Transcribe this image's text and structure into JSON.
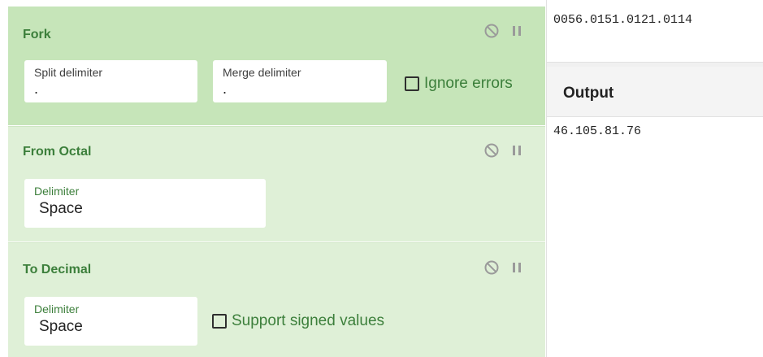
{
  "recipe": {
    "fork": {
      "title": "Fork",
      "split_label": "Split delimiter",
      "split_value": ".",
      "merge_label": "Merge delimiter",
      "merge_value": ".",
      "ignore_errors_label": "Ignore errors",
      "ignore_errors_checked": false
    },
    "from_octal": {
      "title": "From Octal",
      "delimiter_label": "Delimiter",
      "delimiter_value": "Space"
    },
    "to_decimal": {
      "title": "To Decimal",
      "delimiter_label": "Delimiter",
      "delimiter_value": "Space",
      "signed_label": "Support signed values",
      "signed_checked": false
    }
  },
  "icons": {
    "disable": "disable-icon",
    "breakpoint": "pause-icon"
  },
  "colors": {
    "operation_active_bg": "#c6e5b9",
    "operation_bg": "#dff0d7",
    "operation_title": "#3c7f3b"
  },
  "input": {
    "text": "0056.0151.0121.0114"
  },
  "output": {
    "title": "Output",
    "text": "46.105.81.76"
  }
}
